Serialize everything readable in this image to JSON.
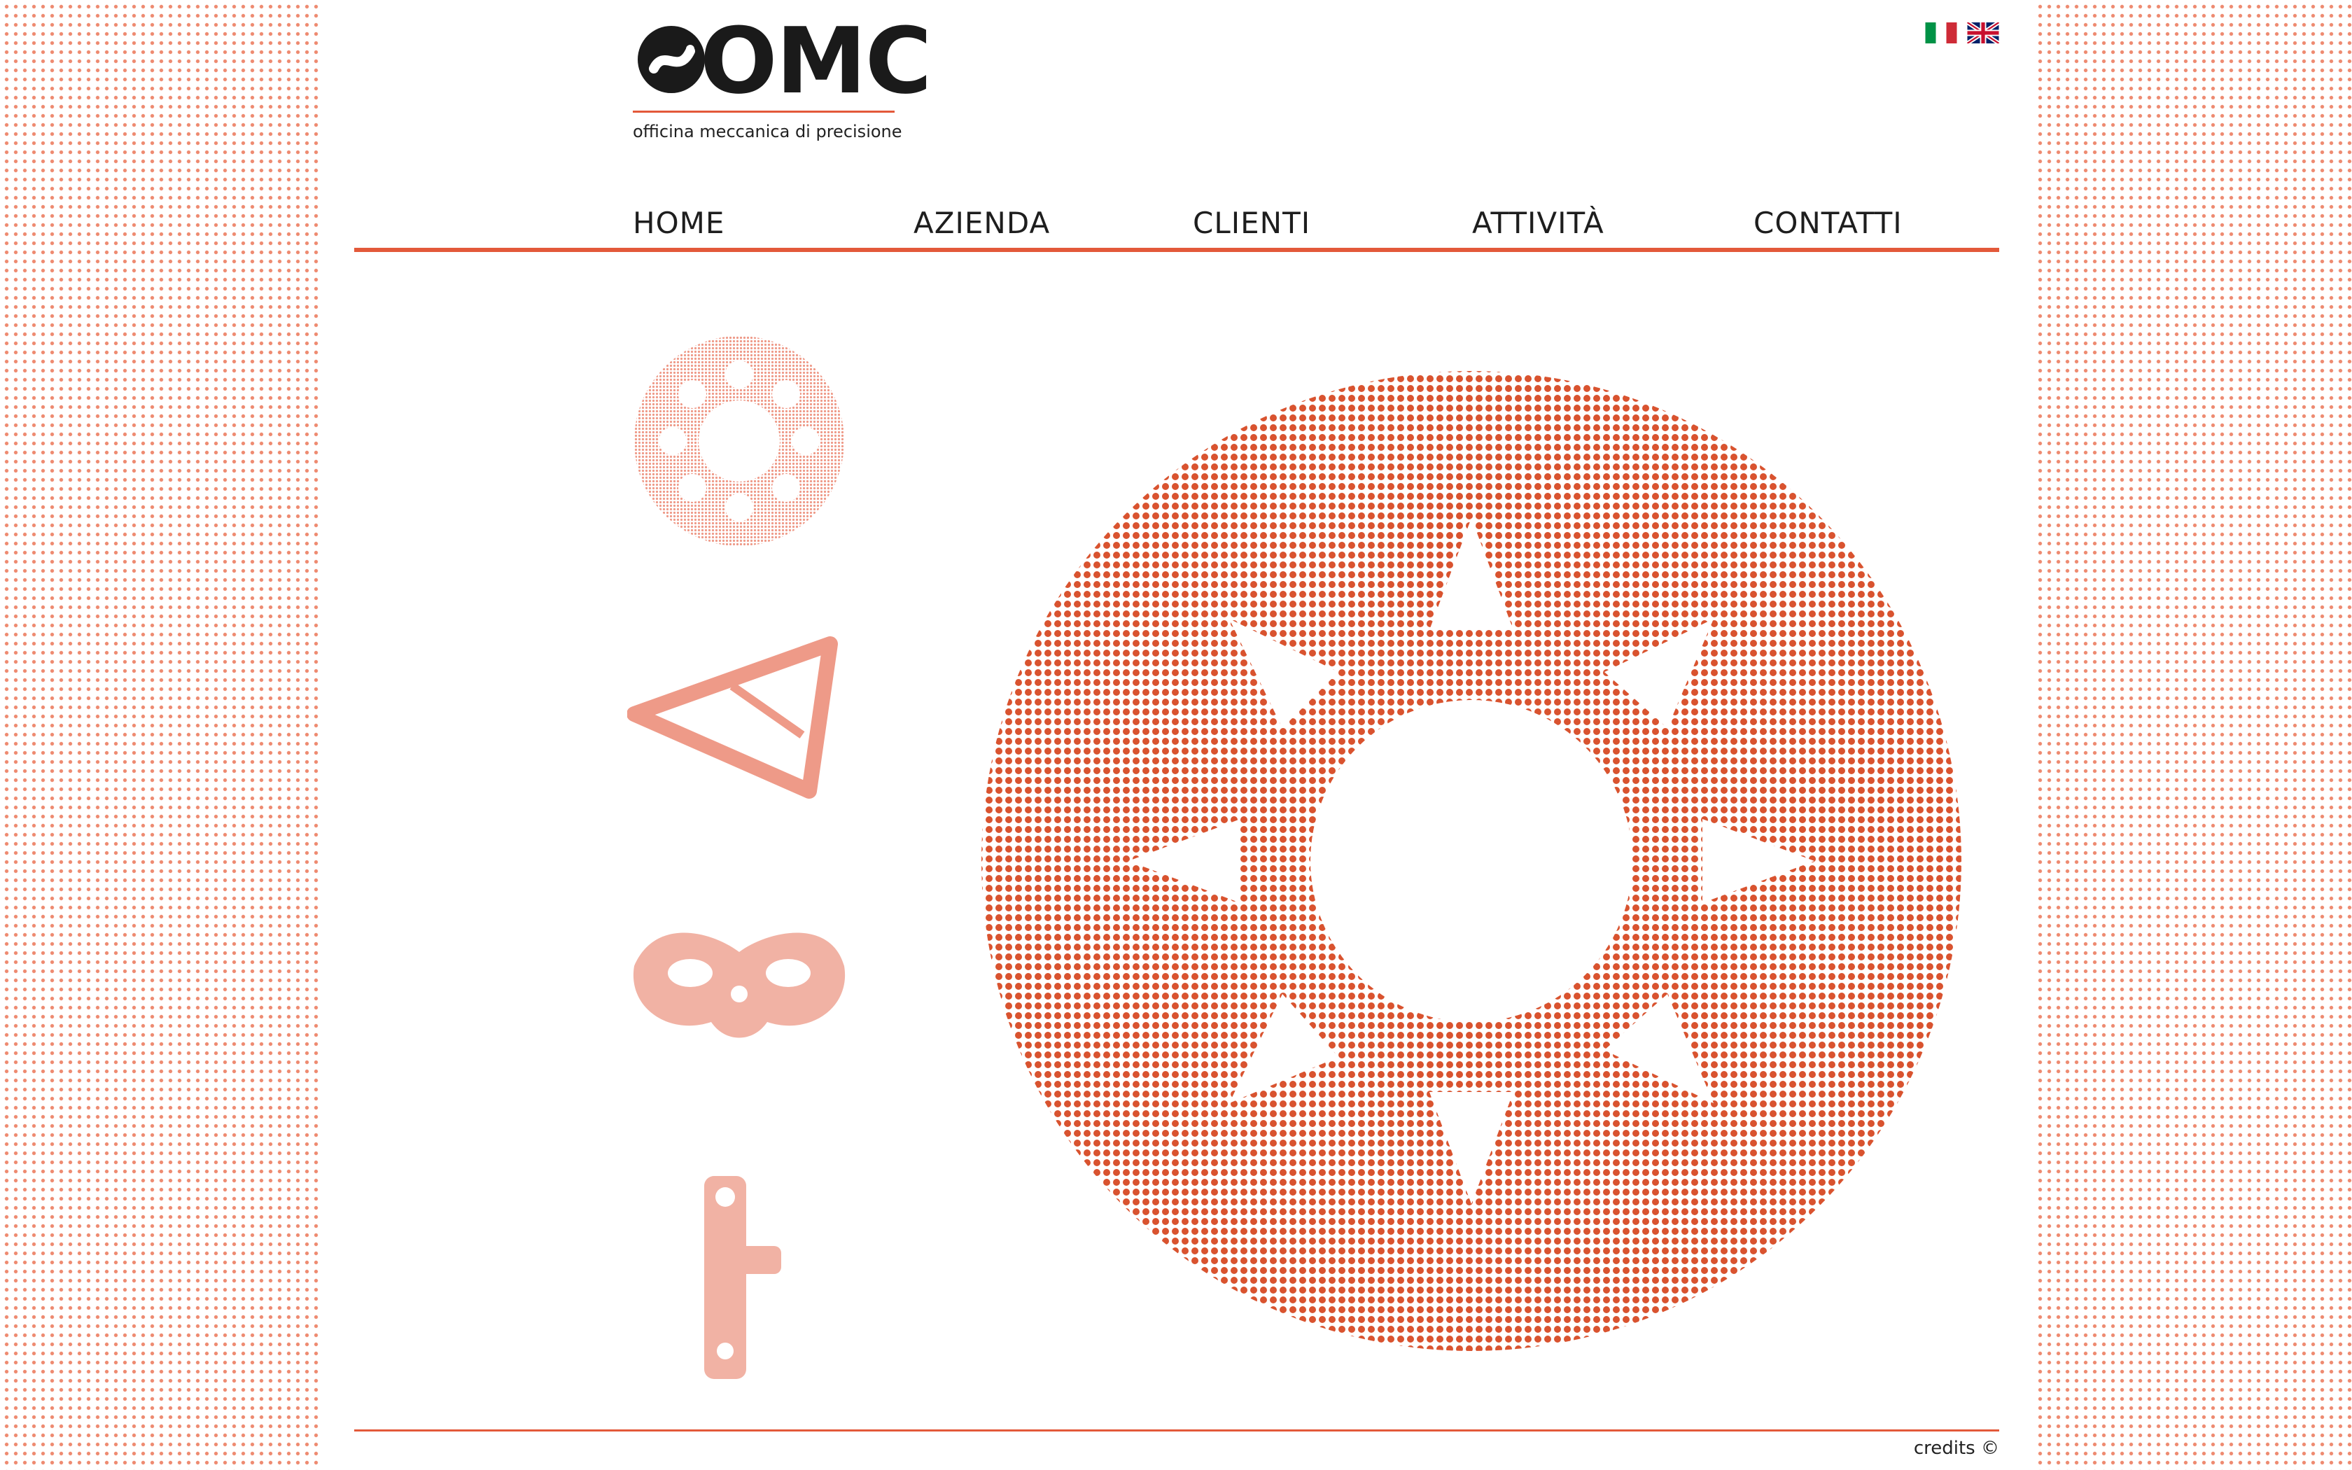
{
  "brand": {
    "name": "OMC",
    "tagline": "officina meccanica di precisione",
    "accent_color": "#e3593a"
  },
  "languages": [
    {
      "code": "it",
      "icon": "italy-flag-icon"
    },
    {
      "code": "en",
      "icon": "uk-flag-icon"
    }
  ],
  "nav": {
    "items": [
      {
        "label": "HOME"
      },
      {
        "label": "AZIENDA"
      },
      {
        "label": "CLIENTI"
      },
      {
        "label": "ATTIVITÀ"
      },
      {
        "label": "CONTATTI"
      }
    ]
  },
  "gallery": {
    "thumbnails": [
      {
        "icon": "sprocket-icon"
      },
      {
        "icon": "triangle-arm-icon"
      },
      {
        "icon": "mask-part-icon"
      },
      {
        "icon": "vertical-bracket-icon"
      }
    ],
    "hero_icon": "large-sprocket-icon"
  },
  "footer": {
    "credits": "credits ©"
  }
}
